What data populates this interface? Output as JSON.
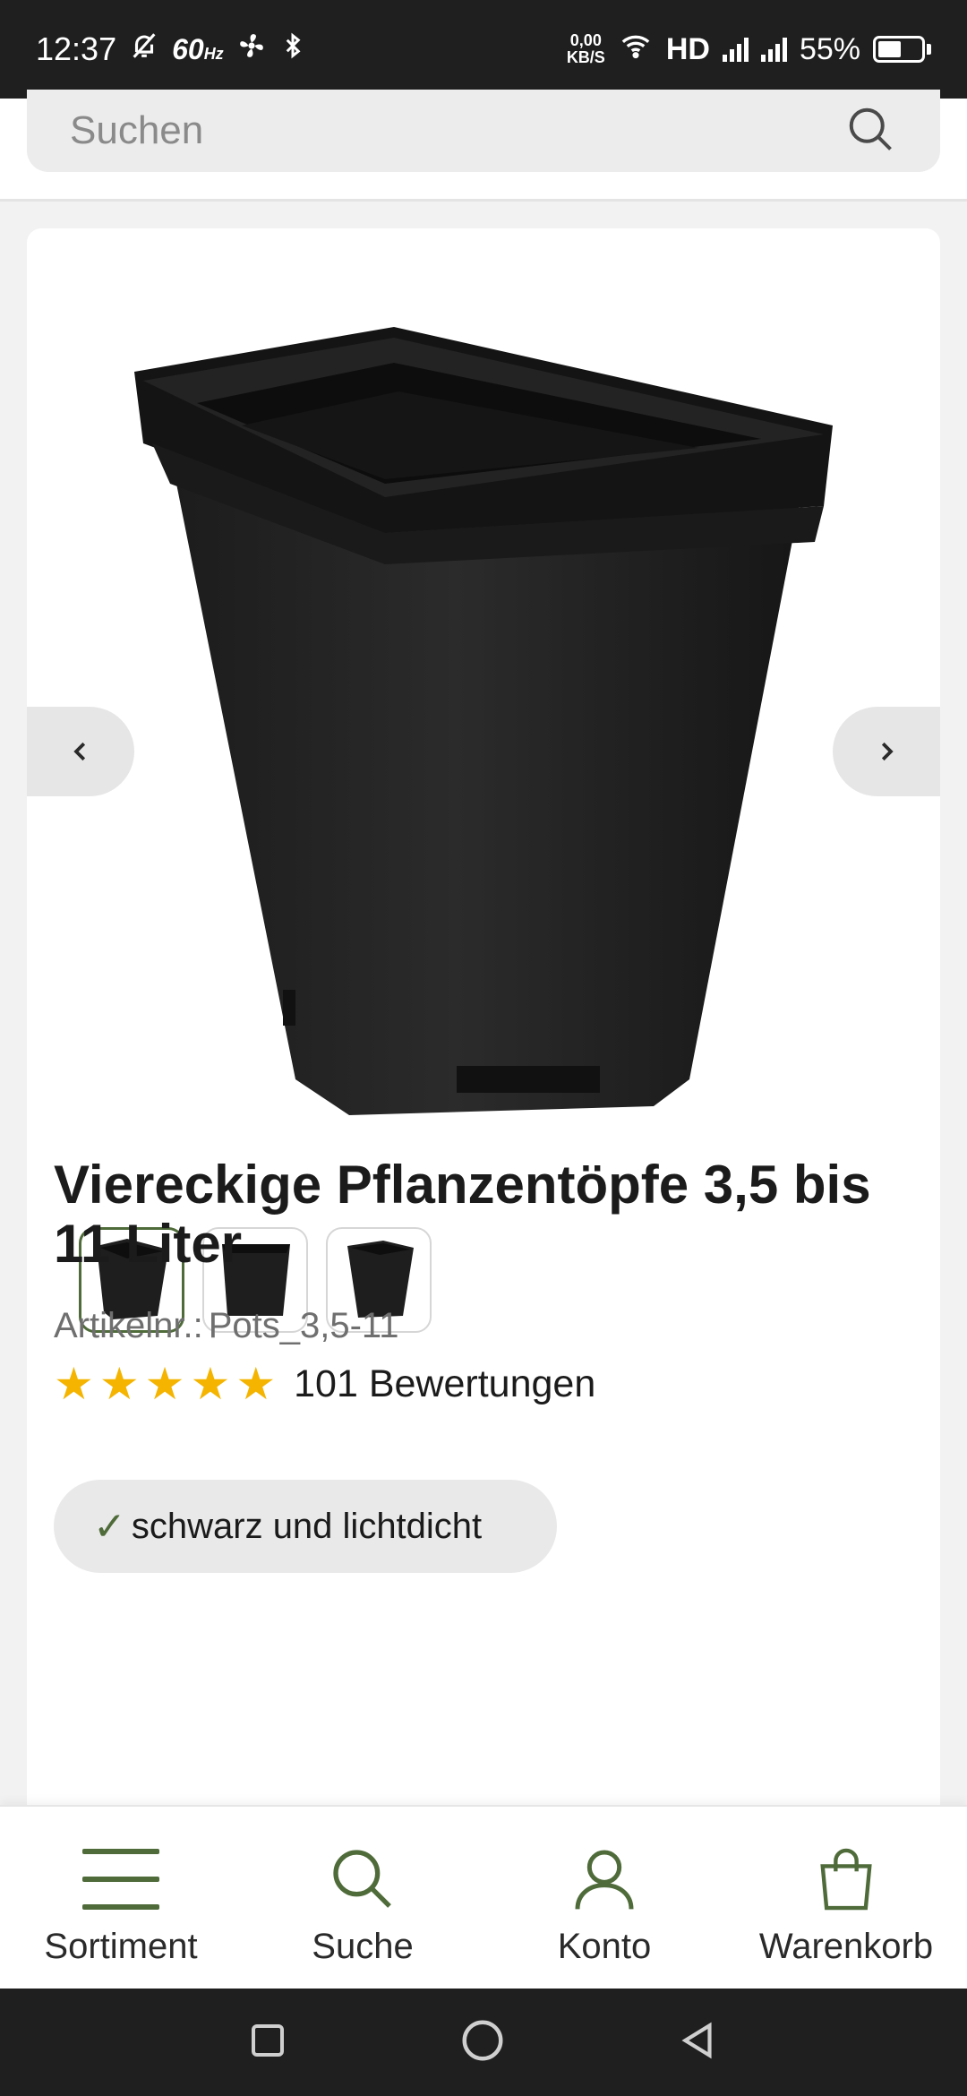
{
  "status_bar": {
    "time": "12:37",
    "refresh_rate": "60",
    "refresh_unit": "Hz",
    "net_speed_value": "0,00",
    "net_speed_unit": "KB/S",
    "network_label": "HD",
    "battery": "55%"
  },
  "search": {
    "placeholder": "Suchen"
  },
  "product": {
    "title": "Viereckige Pflanzentöpfe 3,5 bis 11 Liter",
    "article_label": "Artikelnr.:",
    "article_number": "Pots_3,5-11",
    "rating_stars": 5,
    "rating_count": "101 Bewertungen",
    "feature": "schwarz und lichtdicht",
    "thumbnail_count": 3,
    "selected_thumbnail": 1
  },
  "bottom_nav": {
    "items": [
      {
        "label": "Sortiment",
        "icon": "menu-icon"
      },
      {
        "label": "Suche",
        "icon": "search-icon"
      },
      {
        "label": "Konto",
        "icon": "user-icon"
      },
      {
        "label": "Warenkorb",
        "icon": "shopping-bag-icon"
      }
    ]
  },
  "colors": {
    "accent": "#4f6b3a",
    "star": "#f4b400",
    "status_bar": "#1f1f1f"
  }
}
